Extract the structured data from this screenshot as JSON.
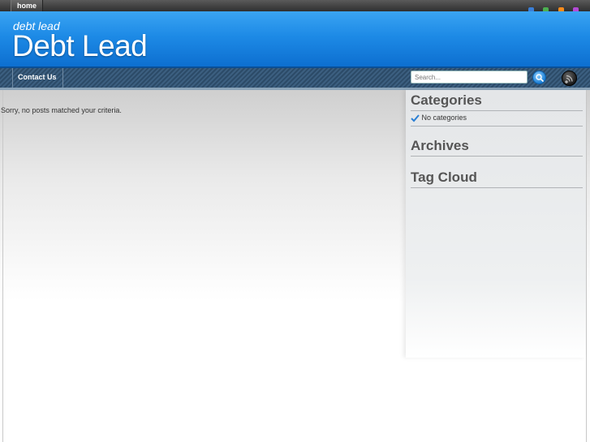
{
  "topbar": {
    "tab_label": "home",
    "icons": [
      {
        "name": "blue-icon",
        "color": "#3a7fd8"
      },
      {
        "name": "green-icon",
        "color": "#4caf50"
      },
      {
        "name": "orange-icon",
        "color": "#ff8c1a"
      },
      {
        "name": "purple-icon",
        "color": "#b44ad6"
      }
    ]
  },
  "header": {
    "tagline": "debt lead",
    "title": "Debt Lead"
  },
  "nav": {
    "items": [
      "Contact Us"
    ]
  },
  "search": {
    "placeholder": "Search..."
  },
  "main": {
    "message": "Sorry, no posts matched your criteria."
  },
  "sidebar": {
    "categories_title": "Categories",
    "categories_item": "No categories",
    "archives_title": "Archives",
    "tagcloud_title": "Tag Cloud"
  }
}
